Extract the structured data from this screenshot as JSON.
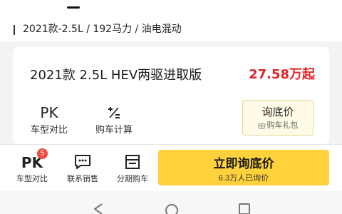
{
  "filter": {
    "text": "2021款-2.5L / 192马力 / 油电混动"
  },
  "card": {
    "model_name": "2021款 2.5L HEV两驱进取版",
    "price": "27.58万起",
    "actions": [
      {
        "icon": "PK",
        "label": "车型对比"
      },
      {
        "icon": "⁺⁄₌",
        "label": "购车计算"
      }
    ],
    "inquiry": {
      "title": "询底价",
      "subtitle": "购车礼包",
      "icon": "gift-icon"
    }
  },
  "bottom_bar": {
    "compare": {
      "icon": "PK",
      "label": "车型对比",
      "badge": "5"
    },
    "contact": {
      "icon": "chat-icon",
      "label": "联系销售"
    },
    "finance": {
      "icon": "receipt-icon",
      "label": "分期购车"
    },
    "cta": {
      "title": "立即询底价",
      "subtitle": "6.3万人已询价"
    }
  },
  "colors": {
    "accent": "#ffd13b",
    "price": "#e2242a",
    "badge": "#f04a3e"
  },
  "nav": {
    "icons": [
      "back-icon",
      "home-icon",
      "recents-icon"
    ]
  }
}
